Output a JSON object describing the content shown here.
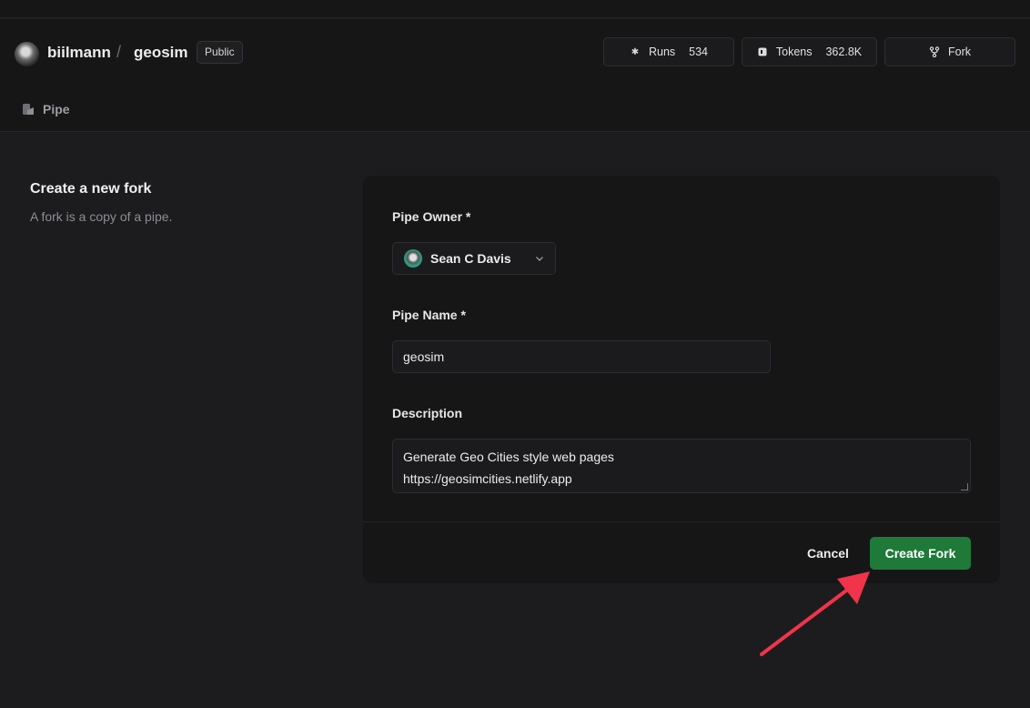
{
  "header": {
    "owner": "biilmann",
    "separator": "/",
    "repo": "geosim",
    "visibility": "Public",
    "stats": {
      "runs_label": "Runs",
      "runs_value": "534",
      "tokens_label": "Tokens",
      "tokens_value": "362.8K",
      "fork_label": "Fork"
    },
    "tab": "Pipe"
  },
  "page": {
    "title": "Create a new fork",
    "subtitle": "A fork is a copy of a pipe."
  },
  "form": {
    "owner_label": "Pipe Owner *",
    "owner_value": "Sean C Davis",
    "name_label": "Pipe Name *",
    "name_value": "geosim",
    "description_label": "Description",
    "description_lines": [
      "Generate Geo Cities style web pages",
      "https://geosimcities.netlify.app"
    ],
    "cancel_label": "Cancel",
    "create_label": "Create Fork"
  },
  "colors": {
    "primary_button": "#1f7a3a",
    "annotation_arrow": "#f0344a"
  },
  "icons": {
    "runs": "asterisk-icon",
    "tokens": "token-icon",
    "fork": "fork-icon",
    "pipe": "pipe-icon",
    "select": "chevron-down-icon"
  }
}
